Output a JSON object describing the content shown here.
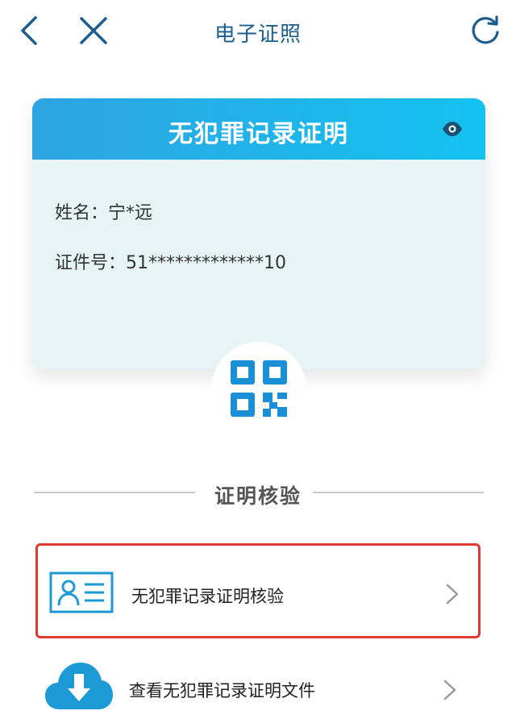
{
  "header": {
    "title": "电子证照"
  },
  "card": {
    "title": "无犯罪记录证明",
    "name_label": "姓名：",
    "name_value": "宁*远",
    "id_label": "证件号：",
    "id_value": "51*************10"
  },
  "verify": {
    "section_title": "证明核验",
    "items": [
      {
        "label": "无犯罪记录证明核验",
        "icon": "id-card-icon"
      },
      {
        "label": "查看无犯罪记录证明文件",
        "icon": "cloud-download-icon"
      }
    ]
  },
  "colors": {
    "accent": "#1c9ad6",
    "title": "#1c5f8f",
    "highlight_border": "#e03a31"
  }
}
